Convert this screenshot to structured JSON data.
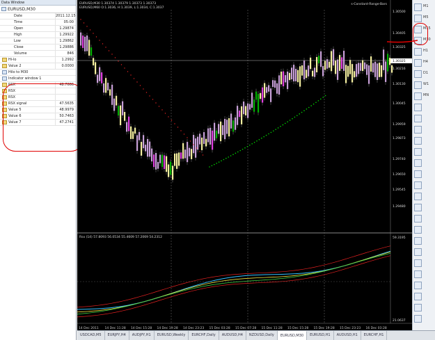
{
  "data_window": {
    "title": "Data Window",
    "symbol": "EURUSD,M30",
    "rows": [
      {
        "label": "Date",
        "value": "2011.12.15"
      },
      {
        "label": "Time",
        "value": "05:00"
      },
      {
        "label": "Open",
        "value": "1.29874"
      },
      {
        "label": "High",
        "value": "1.29922"
      },
      {
        "label": "Low",
        "value": "1.29862"
      },
      {
        "label": "Close",
        "value": "1.29886"
      },
      {
        "label": "Volume",
        "value": "846"
      }
    ],
    "ind_rows_1": [
      {
        "label": "Hi-lo",
        "value": "1.2992"
      },
      {
        "label": "Value 2",
        "value": "0.0000"
      }
    ],
    "section_m30": "Hilo to M30",
    "section_ind": "Indicator window 1",
    "ind_rows_2": [
      {
        "label": "RSX",
        "value": "48.7666"
      },
      {
        "label": "RSX",
        "value": ""
      },
      {
        "label": "RSX",
        "value": ""
      },
      {
        "label": "RSX signal",
        "value": "47.5635"
      },
      {
        "label": "Value 5",
        "value": "48.9979"
      },
      {
        "label": "Value 6",
        "value": "50.7463"
      },
      {
        "label": "Value 7",
        "value": "47.2741"
      }
    ]
  },
  "chart": {
    "header_line1": "EURUSD,M30  1.30374 1.30379 1.30373 1.30373",
    "header_line2": "EURUSD,M60  O:1.3036, H:1.3039, L:1.3034, C:1.3037",
    "indicator_name": "s-Constant-Range-Bars",
    "price_labels": [
      "1.30500",
      "1.30405",
      "1.30325",
      "1.30216",
      "1.30130",
      "1.30045",
      "1.29959",
      "1.29873",
      "1.29740",
      "1.29650",
      "1.29545",
      "1.29480"
    ],
    "current_price": "1.30325",
    "sub_header": "Rsx (14) 57.8093 56.0534 55.4609 57.2069 54.2312",
    "sub_labels": [
      "59.3195",
      "21.0637"
    ],
    "time_labels": [
      "14 Dec 2011",
      "14 Dec 11:28",
      "14 Dec 15:28",
      "14 Dec 19:28",
      "14 Dec 23:23",
      "15 Dec 03:28",
      "15 Dec 07:28",
      "15 Dec 11:28",
      "15 Dec 15:28",
      "15 Dec 19:28",
      "15 Dec 23:23",
      "16 Dec 03:28"
    ]
  },
  "toolbar": {
    "labels": [
      "M1",
      "M5",
      "M15",
      "M30",
      "H1",
      "H4",
      "D1",
      "W1",
      "MN"
    ]
  },
  "tabs": [
    "USDCAD,M5",
    "EURJPY,H4",
    "AUDJPY,H1",
    "EURUSD,Weekly",
    "EURCHF,Daily",
    "AUDUSD,H4",
    "NZDUSD,Daily",
    "EURUSD,M30",
    "EURUSD,H1",
    "AUDUSD,H1",
    "EURCHF,H1"
  ],
  "active_tab": 7,
  "colors": {
    "bull": "#f5f0a0",
    "bear": "#c8a0d8",
    "green_body": "#00b000",
    "magenta": "#e040e0",
    "red_dots": "#e02020",
    "green_dots": "#00d000"
  }
}
